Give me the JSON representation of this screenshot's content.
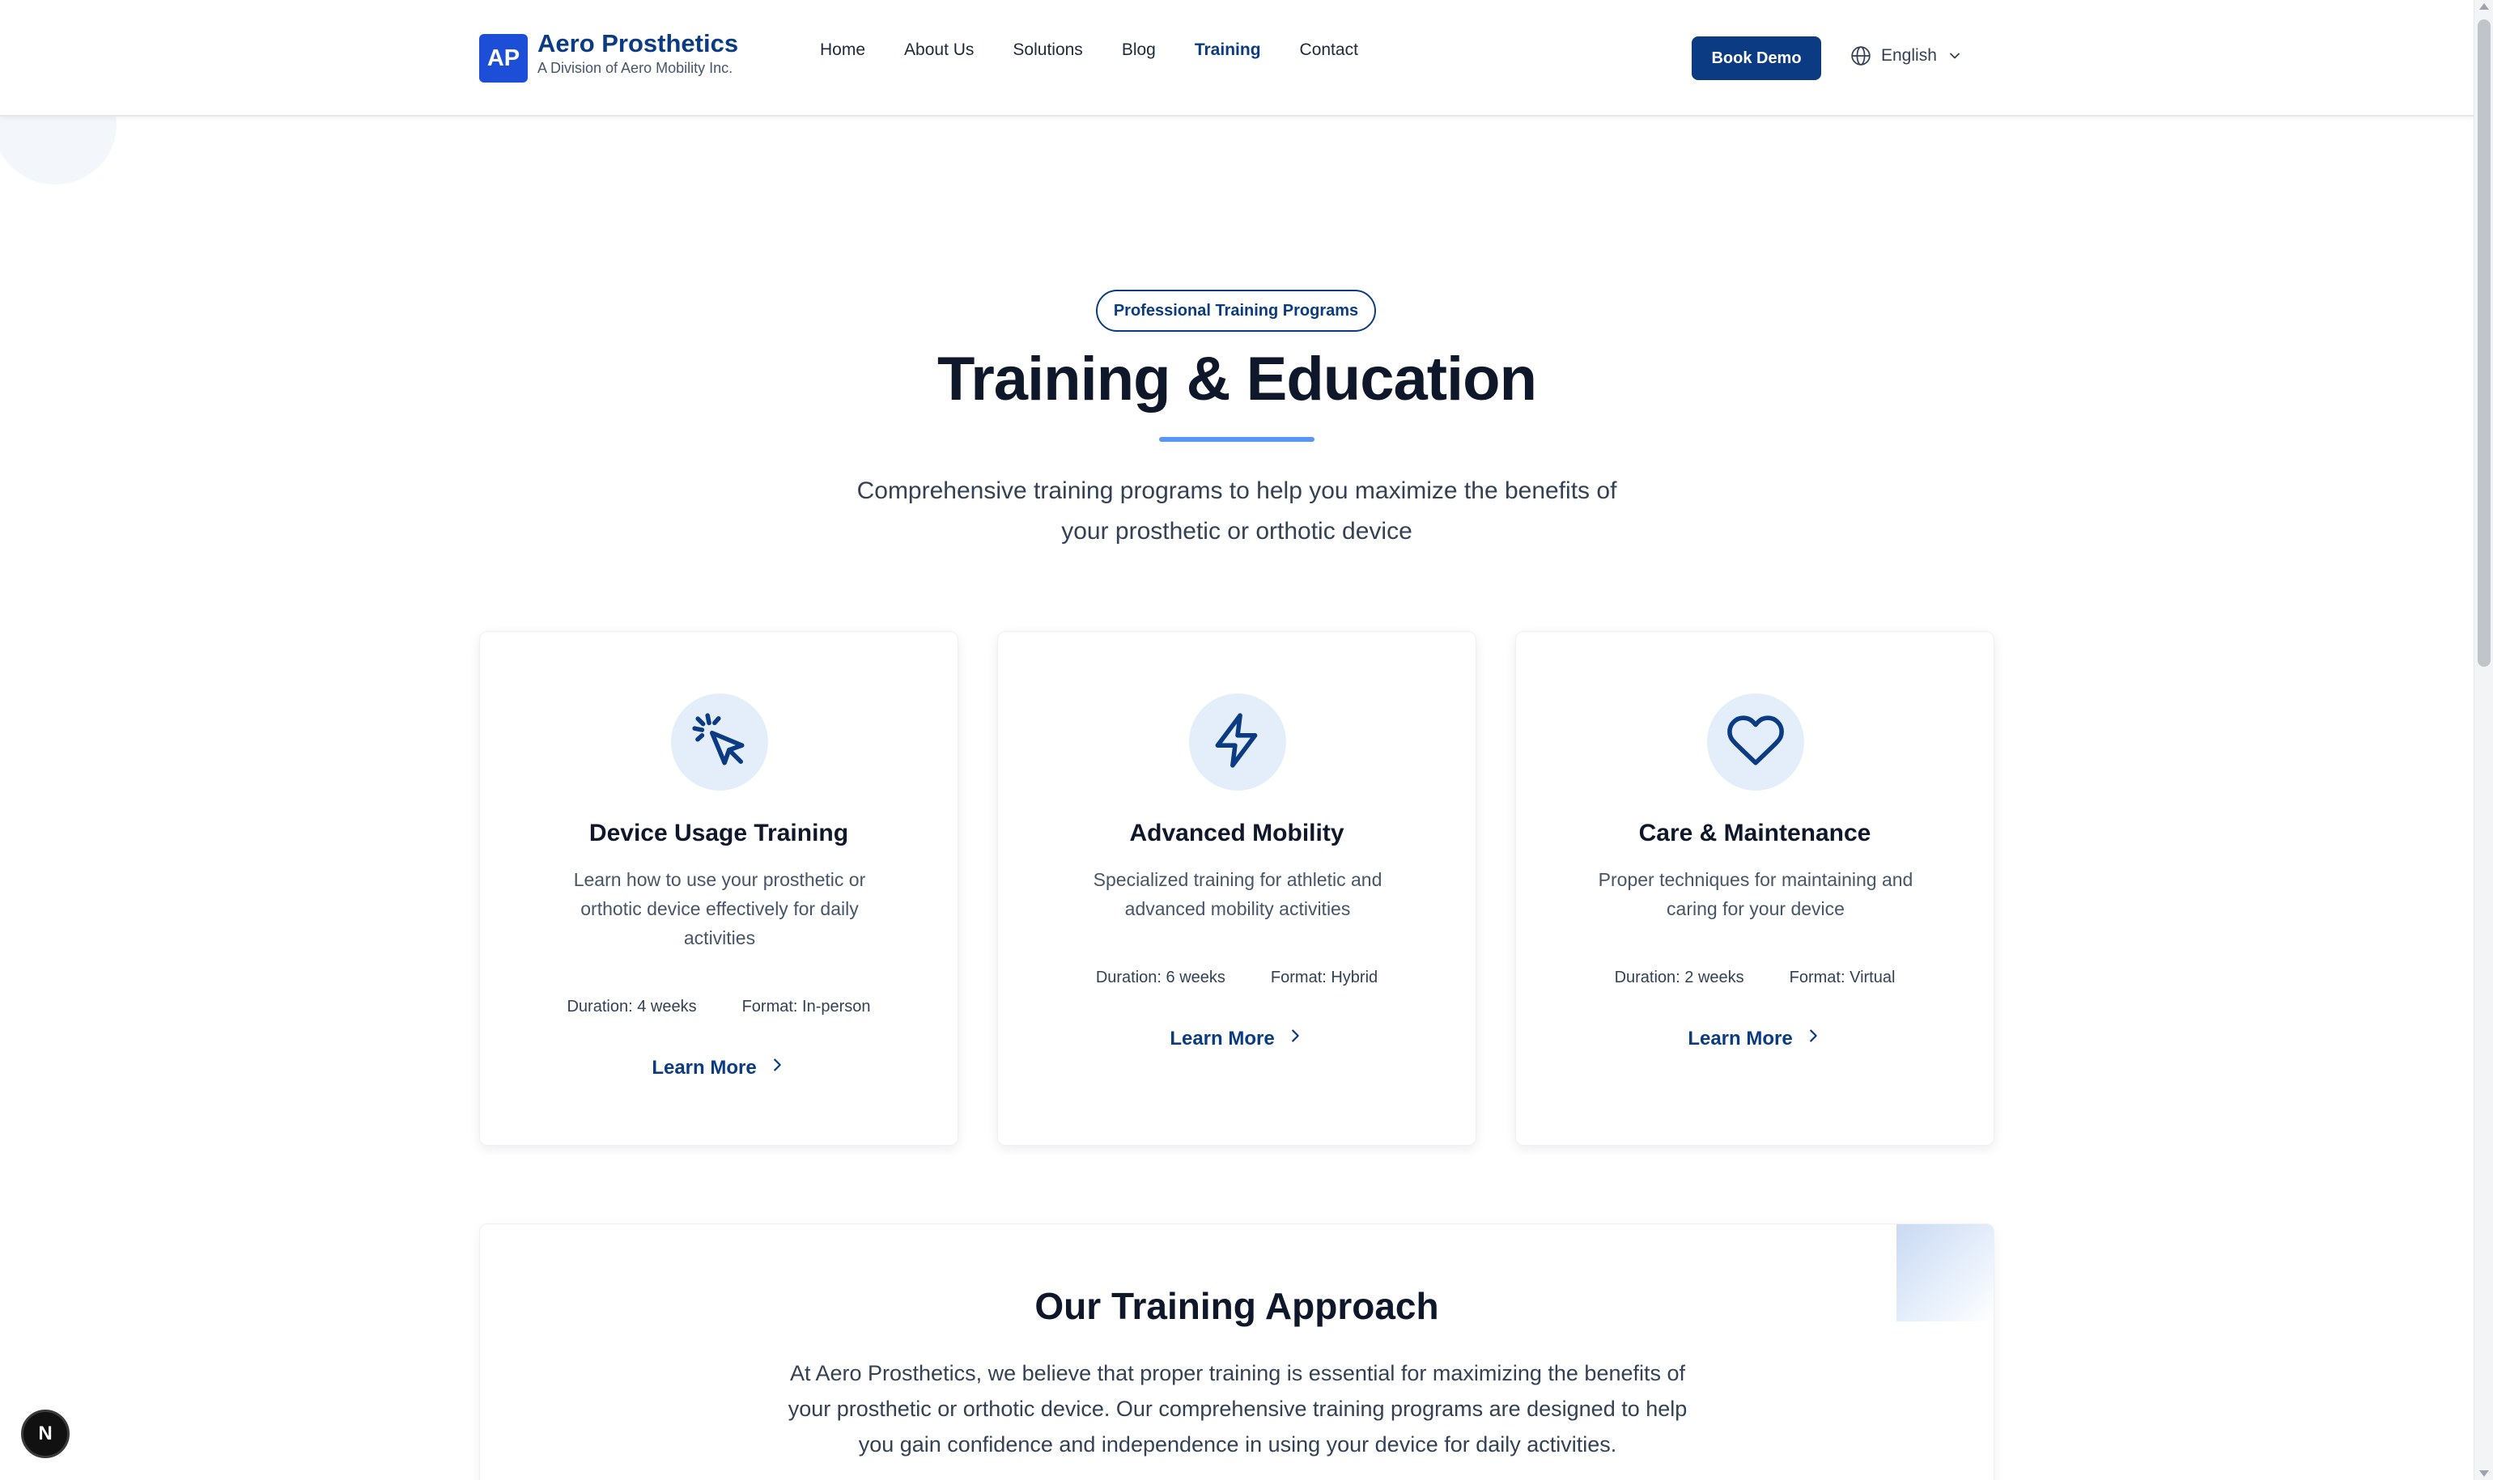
{
  "brand": {
    "logo_text": "AP",
    "name": "Aero Prosthetics",
    "tagline": "A Division of Aero Mobility Inc."
  },
  "nav": {
    "items": [
      {
        "label": "Home"
      },
      {
        "label": "About Us"
      },
      {
        "label": "Solutions"
      },
      {
        "label": "Blog"
      },
      {
        "label": "Training",
        "active": true
      },
      {
        "label": "Contact"
      }
    ]
  },
  "header": {
    "cta_label": "Book Demo",
    "language": "English",
    "language_icon": "globe-icon"
  },
  "hero": {
    "badge": "Professional Training Programs",
    "title": "Training & Education",
    "subtitle": "Comprehensive training programs to help you maximize the benefits of your prosthetic or orthotic device"
  },
  "programs": [
    {
      "icon": "cursor-click-icon",
      "title": "Device Usage Training",
      "description": "Learn how to use your prosthetic or orthotic device effectively for daily activities",
      "duration": "Duration: 4 weeks",
      "format": "Format: In-person",
      "link": "Learn More"
    },
    {
      "icon": "lightning-icon",
      "title": "Advanced Mobility",
      "description": "Specialized training for athletic and advanced mobility activities",
      "duration": "Duration: 6 weeks",
      "format": "Format: Hybrid",
      "link": "Learn More"
    },
    {
      "icon": "heart-icon",
      "title": "Care & Maintenance",
      "description": "Proper techniques for maintaining and caring for your device",
      "duration": "Duration: 2 weeks",
      "format": "Format: Virtual",
      "link": "Learn More"
    }
  ],
  "approach": {
    "title": "Our Training Approach",
    "text": "At Aero Prosthetics, we believe that proper training is essential for maximizing the benefits of your prosthetic or orthotic device. Our comprehensive training programs are designed to help you gain confidence and independence in using your device for daily activities."
  },
  "dev_badge": "N",
  "colors": {
    "primary": "#0b3b82",
    "accent": "#3b82f6",
    "icon_bg": "#e3eefa",
    "text": "#0f172a"
  }
}
